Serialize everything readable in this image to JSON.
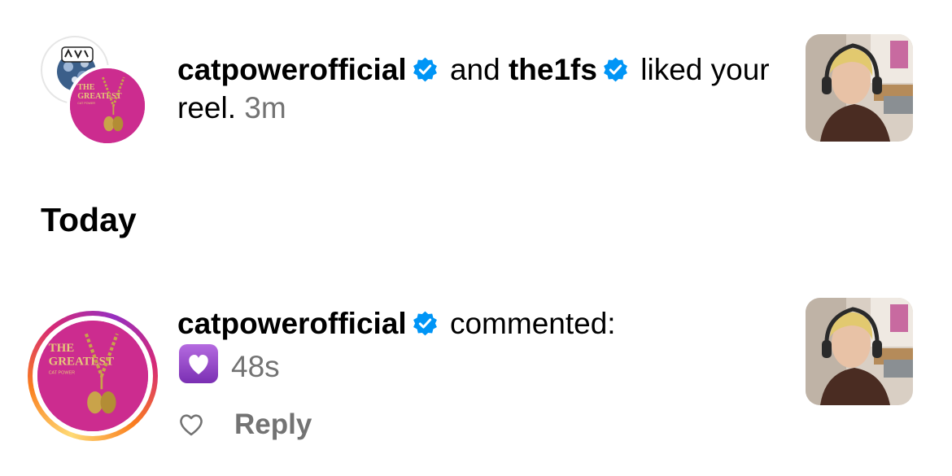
{
  "notifications": [
    {
      "users": [
        "catpowerofficial",
        "the1fs"
      ],
      "joiner": "and",
      "action": "liked your reel.",
      "time": "3m",
      "avatar_text": "THE GREATEST",
      "avatar_subtext": "CAT POWER"
    },
    {
      "user": "catpowerofficial",
      "action": "commented:",
      "comment_emoji": "purple-heart",
      "time": "48s",
      "reply_label": "Reply",
      "avatar_text": "THE GREATEST",
      "avatar_subtext": "CAT POWER"
    }
  ],
  "section": {
    "heading": "Today"
  },
  "colors": {
    "verified": "#0095f6",
    "timestamp": "#737373",
    "album_pink": "#cc2c8f",
    "gold": "#c9a34a"
  }
}
